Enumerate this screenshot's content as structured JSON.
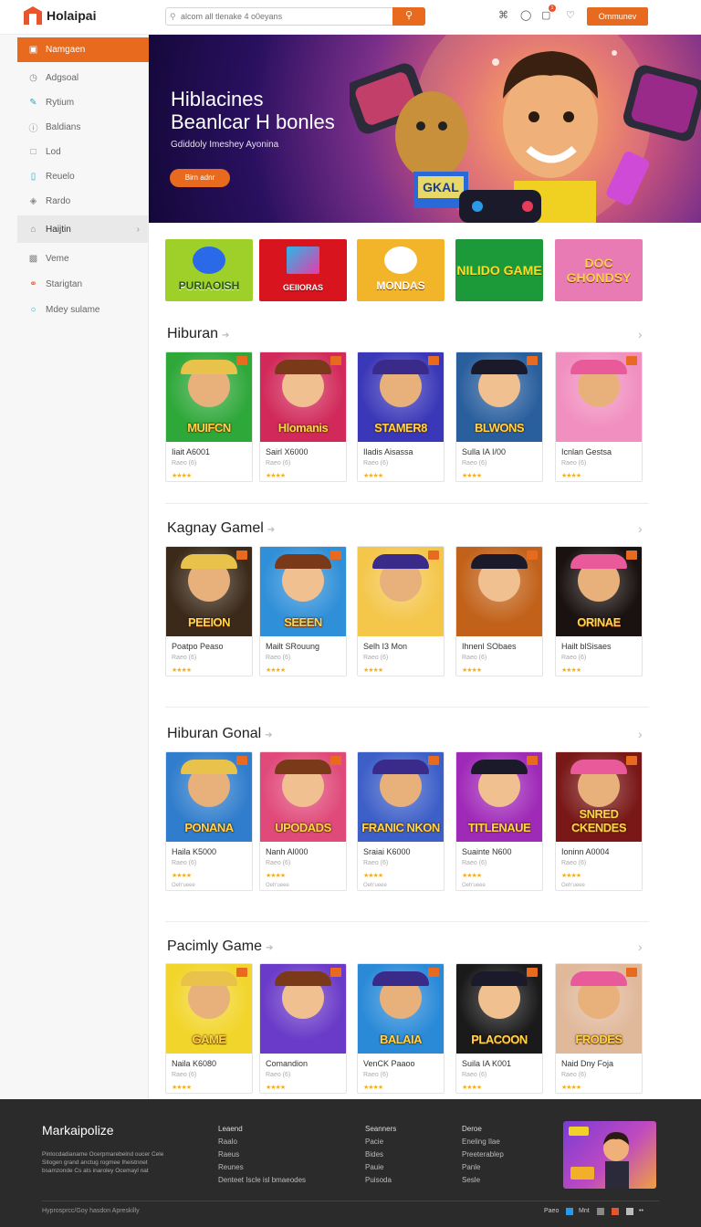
{
  "header": {
    "logo_text": "Holaipai",
    "search_placeholder": "alcom all tlenake 4 o0eyans",
    "cta_label": "Ommunev",
    "notif_count": "1"
  },
  "sidebar": {
    "items": [
      {
        "label": "Namgaen",
        "icon": "box-icon"
      },
      {
        "label": "Adgsoal",
        "icon": "clock-icon"
      },
      {
        "label": "Rytium",
        "icon": "pencil-icon"
      },
      {
        "label": "Baldians",
        "icon": "info-icon"
      },
      {
        "label": "Lod",
        "icon": "folder-icon"
      },
      {
        "label": "Reuelo",
        "icon": "chat-icon"
      },
      {
        "label": "Rardo",
        "icon": "tag-icon"
      },
      {
        "label": "Haijtin",
        "icon": "home-icon"
      },
      {
        "label": "Veme",
        "icon": "image-icon"
      },
      {
        "label": "Starigtan",
        "icon": "link-icon"
      },
      {
        "label": "Mdey sulame",
        "icon": "circle-icon"
      }
    ]
  },
  "hero": {
    "title_line1": "Hiblacines",
    "title_line2": "Beanlcar H bonles",
    "subtitle": "Gdiddoly Imeshey Ayonina",
    "button": "Birn adnr",
    "art_label": "GKAL"
  },
  "categories": [
    {
      "label": "PURIAOISH",
      "bg": "#9fd02a"
    },
    {
      "label": "GEIIORAS",
      "bg": "#d8141f"
    },
    {
      "label": "MONDAS",
      "bg": "#f2b52a"
    },
    {
      "label": "NILIDO GAME",
      "bg": "#1c9a3a"
    },
    {
      "label": "DOC GHONDSY",
      "bg": "#e87ab4"
    }
  ],
  "sections": [
    {
      "title": "Hiburan",
      "cards": [
        {
          "name": "Iiait A6001",
          "sub": "Raeo (6)",
          "art": "MUIFCN",
          "bg": "#2fa83a"
        },
        {
          "name": "Sairl X6000",
          "sub": "Raeo (6)",
          "art": "Hlomanis",
          "bg": "#d12a5a"
        },
        {
          "name": "Iladis Aisassa",
          "sub": "Raeo (6)",
          "art": "STAMER8",
          "bg": "#3a37b8"
        },
        {
          "name": "Sulla IA I/00",
          "sub": "Raeo (6)",
          "art": "BLWONS",
          "bg": "#2a5f9e"
        },
        {
          "name": "Icnlan Gestsa",
          "sub": "Raeo (6)",
          "art": "",
          "bg": "#f18fc0"
        }
      ],
      "stars": "★★★★"
    },
    {
      "title": "Kagnay Gamel",
      "cards": [
        {
          "name": "Poatpo Peaso",
          "sub": "Raeo (6)",
          "art": "PEEION",
          "bg": "#3b2a1a"
        },
        {
          "name": "Mailt SRouung",
          "sub": "Raeo (6)",
          "art": "SEEEN",
          "bg": "#2f8fd8"
        },
        {
          "name": "Selh I3 Mon",
          "sub": "Raeo (6)",
          "art": "",
          "bg": "#f4c64a"
        },
        {
          "name": "Ihnenl SObaes",
          "sub": "Raeo (6)",
          "art": "",
          "bg": "#c2621a"
        },
        {
          "name": "Hailt blSisaes",
          "sub": "Raeo (6)",
          "art": "ORINAE",
          "bg": "#1a1210"
        }
      ],
      "stars": "★★★★"
    },
    {
      "title": "Hiburan Gonal",
      "cards": [
        {
          "name": "Haila K5000",
          "sub": "Raeo (6)",
          "art": "PONANA",
          "bg": "#2f7dcc"
        },
        {
          "name": "Nanh Al000",
          "sub": "Raeo (6)",
          "art": "UPODADS",
          "bg": "#e04a7a"
        },
        {
          "name": "Sraiai K6000",
          "sub": "Raeo (6)",
          "art": "FRANIC NKON",
          "bg": "#3d5fc8"
        },
        {
          "name": "Suainte N600",
          "sub": "Raeo (6)",
          "art": "TITLENAUE",
          "bg": "#a02ab8"
        },
        {
          "name": "Ioninn A0004",
          "sub": "Raeo (6)",
          "art": "SNRED CKENDES",
          "bg": "#7a1818"
        }
      ],
      "stars": "★★★★",
      "extra": "Oeh'ueee"
    },
    {
      "title": "Pacimly Game",
      "cards": [
        {
          "name": "Naila K6080",
          "sub": "Raeo (6)",
          "art": "GAME",
          "bg": "#f2d52a"
        },
        {
          "name": "Comandion",
          "sub": "Raeo (6)",
          "art": "",
          "bg": "#6a3ac8"
        },
        {
          "name": "VenCK Paaoo",
          "sub": "Raeo (6)",
          "art": "BALAIA",
          "bg": "#2a8ad8"
        },
        {
          "name": "Suila IA K001",
          "sub": "Raeo (6)",
          "art": "PLACOON",
          "bg": "#1a1a1a"
        },
        {
          "name": "Naid Dny Foja",
          "sub": "Raeo (6)",
          "art": "FRODES",
          "bg": "#e0b89a"
        }
      ],
      "stars": "★★★★"
    }
  ],
  "footer": {
    "brand": "Markaipolize",
    "description": "Pinlocdadianame Ocerpmarebelnd oucer Cele Sitogen grand anctug rogmee Iheistnnet bsamzonde Cs ats inaroley Ocemayl nat",
    "col1": [
      "Leaend",
      "Raalo",
      "Raeus",
      "Reunes",
      "Denteet Iscle isl bmaeodes"
    ],
    "col2": [
      "Seanners",
      "Pacie",
      "Bides",
      "Pauie",
      "Puisoda"
    ],
    "col3": [
      "Deroe",
      "Eneling Ilae",
      "Preeterablep",
      "Panle",
      "Sesle"
    ],
    "copyright": "Hyprosprcc/Goy hasdon Apreskilly",
    "pay_label": "Paeo",
    "pay_label2": "Mnt"
  }
}
